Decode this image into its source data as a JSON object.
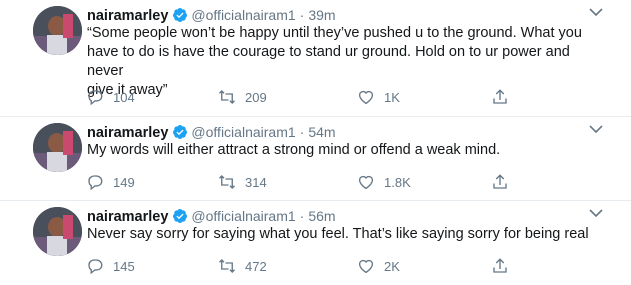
{
  "colors": {
    "verified": "#1da1f2",
    "muted": "#657786",
    "text": "#14171a",
    "divider": "#e6ecf0"
  },
  "tweets": [
    {
      "name": "nairamarley",
      "handle": "@officialnairam1",
      "separator": "·",
      "time": "39m",
      "text": "“Some people won’t be happy until they’ve pushed u to the ground. What you\nhave to do is have the courage to stand ur ground. Hold on to ur power and never\ngive it away”",
      "replies": "104",
      "retweets": "209",
      "likes": "1K"
    },
    {
      "name": "nairamarley",
      "handle": "@officialnairam1",
      "separator": "·",
      "time": "54m",
      "text": "My words will either attract a strong mind or offend a weak mind.",
      "replies": "149",
      "retweets": "314",
      "likes": "1.8K"
    },
    {
      "name": "nairamarley",
      "handle": "@officialnairam1",
      "separator": "·",
      "time": "56m",
      "text": "Never say sorry for saying what you feel. That’s like saying sorry for being real",
      "replies": "145",
      "retweets": "472",
      "likes": "2K"
    }
  ],
  "icons": [
    "avatar",
    "verified-badge-icon",
    "caret-down-icon",
    "reply-icon",
    "retweet-icon",
    "like-icon",
    "share-icon"
  ]
}
